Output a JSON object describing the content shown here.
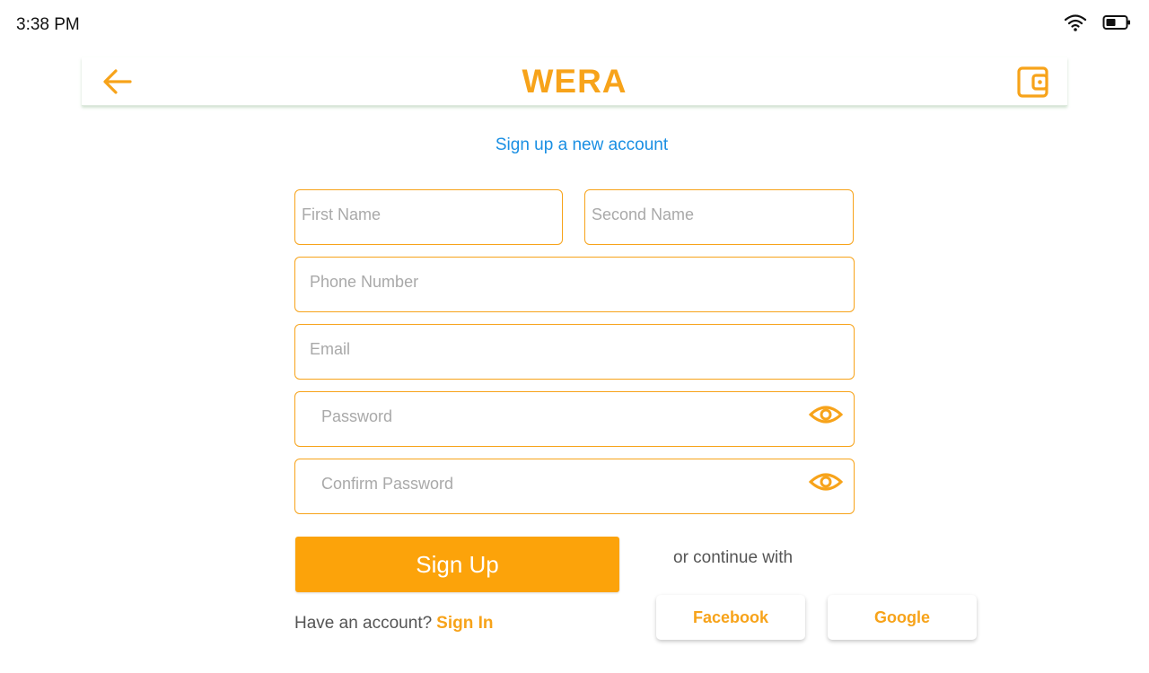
{
  "status_bar": {
    "time": "3:38 PM",
    "wifi_icon": "wifi-icon",
    "battery_icon": "battery-icon"
  },
  "app_bar": {
    "title": "WERA",
    "back_icon": "arrow-left-icon",
    "wallet_icon": "wallet-icon"
  },
  "subtitle": "Sign up a new account",
  "form": {
    "first_name": {
      "placeholder": "First Name",
      "value": ""
    },
    "second_name": {
      "placeholder": "Second Name",
      "value": ""
    },
    "phone": {
      "placeholder": "Phone Number",
      "value": ""
    },
    "email": {
      "placeholder": "Email",
      "value": ""
    },
    "password": {
      "placeholder": "Password",
      "value": "",
      "toggle_icon": "eye-icon"
    },
    "confirm_password": {
      "placeholder": "Confirm Password",
      "value": "",
      "toggle_icon": "eye-icon"
    }
  },
  "signup_button": "Sign Up",
  "or_continue": "or continue with",
  "have_account": "Have an account?",
  "signin_link": "Sign In",
  "social": {
    "facebook": "Facebook",
    "google": "Google"
  },
  "colors": {
    "accent": "#f7a31a",
    "button": "#fca30a",
    "link": "#1a8fe3"
  }
}
